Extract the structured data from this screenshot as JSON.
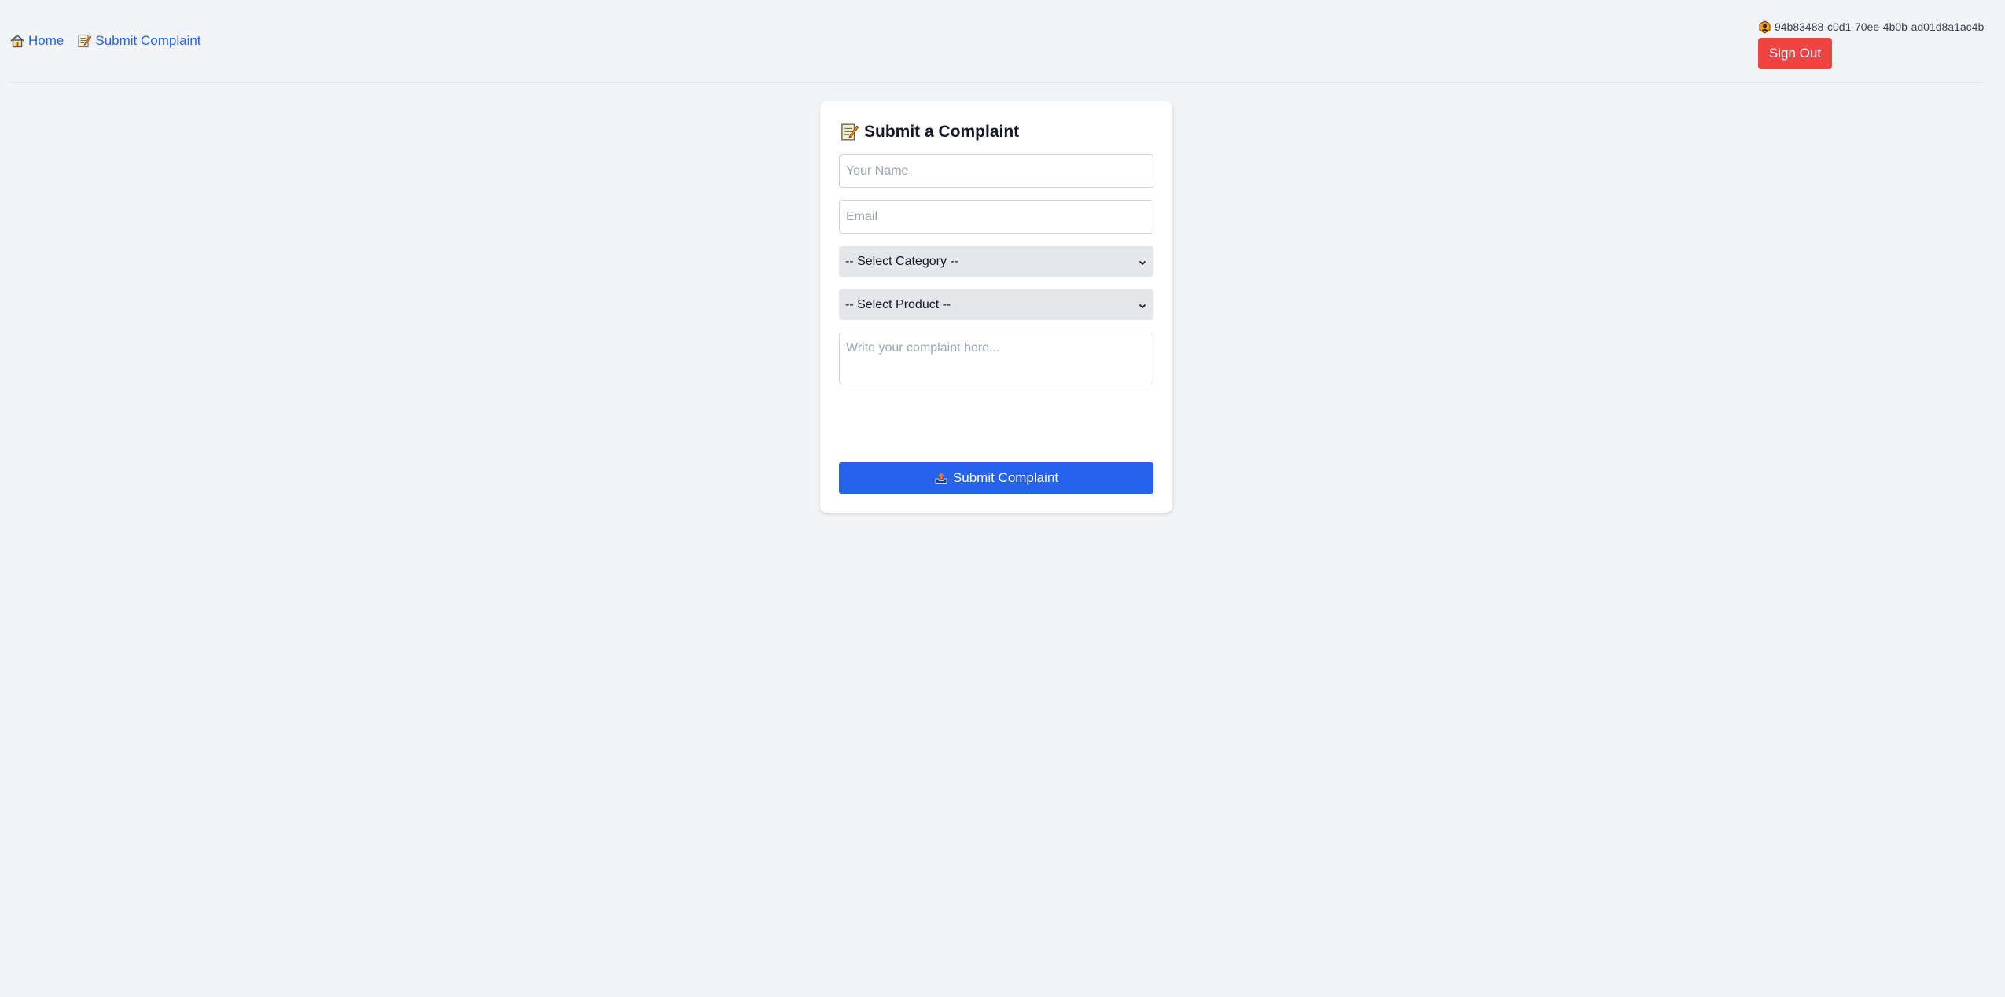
{
  "nav": {
    "home_label": "Home",
    "home_icon": "house-icon",
    "submit_label": "Submit Complaint",
    "submit_icon": "memo-icon"
  },
  "user": {
    "id": "94b83488-c0d1-70ee-4b0b-ad01d8a1ac4b",
    "icon": "user-badge-icon",
    "signout_label": "Sign Out"
  },
  "form": {
    "title": "Submit a Complaint",
    "title_icon": "memo-icon",
    "name_placeholder": "Your Name",
    "email_placeholder": "Email",
    "category_selected": "-- Select Category --",
    "product_selected": "-- Select Product --",
    "complaint_placeholder": "Write your complaint here...",
    "submit_label": "Submit Complaint",
    "submit_icon": "outbox-tray-icon"
  },
  "colors": {
    "background": "#f3f4f6",
    "link": "#2563eb",
    "signout": "#ef4444",
    "primary": "#2563eb",
    "select_bg": "#e5e7eb"
  }
}
